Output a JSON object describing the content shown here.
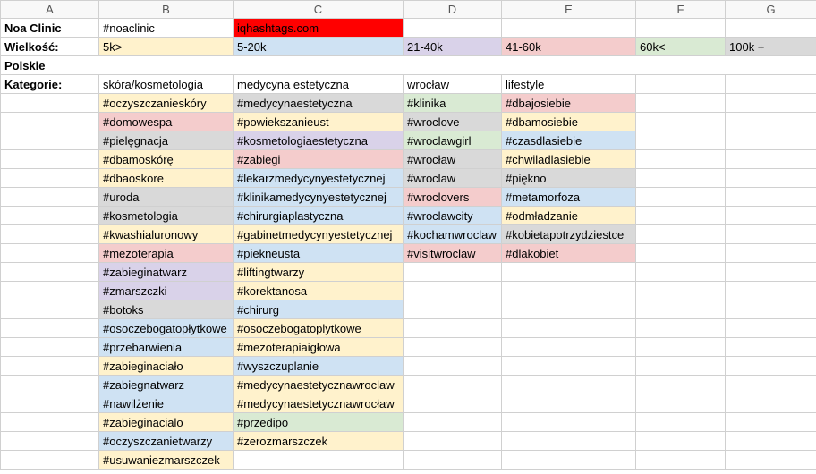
{
  "colors": {
    "red": "#ff0000",
    "yellow": "#fff2cc",
    "blue": "#cfe2f3",
    "purple": "#d9d2e9",
    "pink": "#f4cccc",
    "green": "#d9ead3",
    "gray": "#d9d9d9"
  },
  "columns": [
    "A",
    "B",
    "C",
    "D",
    "E",
    "F",
    "G"
  ],
  "header_row": {
    "A": "Noa Clinic",
    "B": "#noaclinic",
    "C": "iqhashtags.com"
  },
  "size_row": {
    "label": "Wielkość:",
    "b": "5k>",
    "c": "5-20k",
    "d": "21-40k",
    "e": "41-60k",
    "f": "60k<",
    "g": "100k +"
  },
  "section_title": "Polskie",
  "categories_label": "Kategorie:",
  "category_headers": {
    "b": "skóra/kosmetologia",
    "c": "medycyna estetyczna",
    "d": "wrocław",
    "e": "lifestyle"
  },
  "rows": [
    {
      "b": {
        "t": "#oczyszczanieskóry",
        "c": "yellow"
      },
      "c": {
        "t": "#medycynaestetyczna",
        "c": "gray"
      },
      "d": {
        "t": "#klinika",
        "c": "green"
      },
      "e": {
        "t": "#dbajosiebie",
        "c": "pink"
      }
    },
    {
      "b": {
        "t": "#domowespa",
        "c": "pink"
      },
      "c": {
        "t": "#powiekszanieust",
        "c": "yellow"
      },
      "d": {
        "t": "#wroclove",
        "c": "gray"
      },
      "e": {
        "t": "#dbamosiebie",
        "c": "yellow"
      }
    },
    {
      "b": {
        "t": "#pielęgnacja",
        "c": "gray"
      },
      "c": {
        "t": "#kosmetologiaestetyczna",
        "c": "purple"
      },
      "d": {
        "t": "#wroclawgirl",
        "c": "green"
      },
      "e": {
        "t": "#czasdlasiebie",
        "c": "blue"
      }
    },
    {
      "b": {
        "t": "#dbamoskórę",
        "c": "yellow"
      },
      "c": {
        "t": "#zabiegi",
        "c": "pink"
      },
      "d": {
        "t": "#wrocław",
        "c": "gray"
      },
      "e": {
        "t": "#chwiladlasiebie",
        "c": "yellow"
      }
    },
    {
      "b": {
        "t": "#dbaoskore",
        "c": "yellow"
      },
      "c": {
        "t": "#lekarzmedycynyestetycznej",
        "c": "blue"
      },
      "d": {
        "t": "#wroclaw",
        "c": "gray"
      },
      "e": {
        "t": "#piękno",
        "c": "gray"
      }
    },
    {
      "b": {
        "t": "#uroda",
        "c": "gray"
      },
      "c": {
        "t": "#klinikamedycynyestetycznej",
        "c": "blue"
      },
      "d": {
        "t": "#wroclovers",
        "c": "pink"
      },
      "e": {
        "t": "#metamorfoza",
        "c": "blue"
      }
    },
    {
      "b": {
        "t": "#kosmetologia",
        "c": "gray"
      },
      "c": {
        "t": "#chirurgiaplastyczna",
        "c": "blue"
      },
      "d": {
        "t": "#wroclawcity",
        "c": "blue"
      },
      "e": {
        "t": "#odmładzanie",
        "c": "yellow"
      }
    },
    {
      "b": {
        "t": "#kwashialuronowy",
        "c": "yellow"
      },
      "c": {
        "t": "#gabinetmedycynyestetycznej",
        "c": "yellow"
      },
      "d": {
        "t": "#kochamwroclaw",
        "c": "blue"
      },
      "e": {
        "t": "#kobietapotrzydziestce",
        "c": "gray"
      }
    },
    {
      "b": {
        "t": "#mezoterapia",
        "c": "pink"
      },
      "c": {
        "t": "#piekneusta",
        "c": "blue"
      },
      "d": {
        "t": "#visitwroclaw",
        "c": "pink"
      },
      "e": {
        "t": "#dlakobiet",
        "c": "pink"
      }
    },
    {
      "b": {
        "t": "#zabieginatwarz",
        "c": "purple"
      },
      "c": {
        "t": "#liftingtwarzy",
        "c": "yellow"
      }
    },
    {
      "b": {
        "t": "#zmarszczki",
        "c": "purple"
      },
      "c": {
        "t": "#korektanosa",
        "c": "yellow"
      }
    },
    {
      "b": {
        "t": "#botoks",
        "c": "gray"
      },
      "c": {
        "t": "#chirurg",
        "c": "blue"
      }
    },
    {
      "b": {
        "t": "#osoczebogatopłytkowe",
        "c": "blue"
      },
      "c": {
        "t": "#osoczebogatoplytkowe",
        "c": "yellow"
      }
    },
    {
      "b": {
        "t": "#przebarwienia",
        "c": "blue"
      },
      "c": {
        "t": "#mezoterapiaigłowa",
        "c": "yellow"
      }
    },
    {
      "b": {
        "t": "#zabieginaciało",
        "c": "yellow"
      },
      "c": {
        "t": "#wyszczuplanie",
        "c": "blue"
      }
    },
    {
      "b": {
        "t": "#zabiegnatwarz",
        "c": "blue"
      },
      "c": {
        "t": "#medycynaestetycznawroclaw",
        "c": "yellow"
      }
    },
    {
      "b": {
        "t": "#nawilżenie",
        "c": "blue"
      },
      "c": {
        "t": "#medycynaestetycznawrocław",
        "c": "yellow"
      }
    },
    {
      "b": {
        "t": "#zabieginacialo",
        "c": "yellow"
      },
      "c": {
        "t": "#przedipo",
        "c": "green"
      }
    },
    {
      "b": {
        "t": "#oczyszczanietwarzy",
        "c": "blue"
      },
      "c": {
        "t": "#zerozmarszczek",
        "c": "yellow"
      }
    },
    {
      "b": {
        "t": "#usuwaniezmarszczek",
        "c": "yellow"
      }
    }
  ]
}
